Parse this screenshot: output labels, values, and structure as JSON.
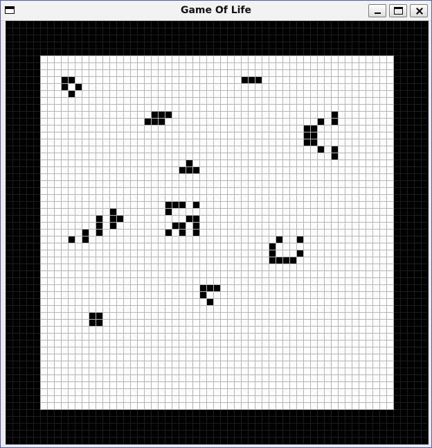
{
  "window": {
    "title": "Game Of Life",
    "buttons": {
      "minimize": "minimize-icon",
      "maximize": "maximize-icon",
      "close": "close-icon"
    }
  },
  "board": {
    "columns": 61,
    "rows": 61,
    "border_cells": 5,
    "colors": {
      "live": "#000000",
      "dead": "#ffffff",
      "grid_line": "#b4b4b4",
      "border": "#000000",
      "border_grid": "#1e1e1e"
    },
    "live_cells": [
      [
        8,
        8
      ],
      [
        9,
        8
      ],
      [
        8,
        9
      ],
      [
        10,
        9
      ],
      [
        9,
        10
      ],
      [
        34,
        8
      ],
      [
        35,
        8
      ],
      [
        36,
        8
      ],
      [
        21,
        13
      ],
      [
        22,
        13
      ],
      [
        23,
        13
      ],
      [
        20,
        14
      ],
      [
        21,
        14
      ],
      [
        22,
        14
      ],
      [
        47,
        13
      ],
      [
        45,
        14
      ],
      [
        47,
        14
      ],
      [
        43,
        15
      ],
      [
        44,
        15
      ],
      [
        43,
        16
      ],
      [
        44,
        16
      ],
      [
        43,
        17
      ],
      [
        44,
        17
      ],
      [
        45,
        18
      ],
      [
        47,
        18
      ],
      [
        47,
        19
      ],
      [
        26,
        20
      ],
      [
        25,
        21
      ],
      [
        26,
        21
      ],
      [
        27,
        21
      ],
      [
        23,
        26
      ],
      [
        24,
        26
      ],
      [
        25,
        26
      ],
      [
        27,
        26
      ],
      [
        15,
        27
      ],
      [
        23,
        27
      ],
      [
        15,
        28
      ],
      [
        16,
        28
      ],
      [
        26,
        28
      ],
      [
        27,
        28
      ],
      [
        13,
        28
      ],
      [
        13,
        29
      ],
      [
        15,
        29
      ],
      [
        24,
        29
      ],
      [
        25,
        29
      ],
      [
        27,
        29
      ],
      [
        13,
        30
      ],
      [
        11,
        30
      ],
      [
        23,
        30
      ],
      [
        25,
        30
      ],
      [
        27,
        30
      ],
      [
        9,
        31
      ],
      [
        11,
        31
      ],
      [
        39,
        31
      ],
      [
        42,
        31
      ],
      [
        38,
        32
      ],
      [
        38,
        33
      ],
      [
        42,
        33
      ],
      [
        38,
        34
      ],
      [
        39,
        34
      ],
      [
        40,
        34
      ],
      [
        41,
        34
      ],
      [
        28,
        38
      ],
      [
        29,
        38
      ],
      [
        30,
        38
      ],
      [
        28,
        39
      ],
      [
        29,
        40
      ],
      [
        12,
        42
      ],
      [
        13,
        42
      ],
      [
        12,
        43
      ],
      [
        13,
        43
      ]
    ]
  }
}
